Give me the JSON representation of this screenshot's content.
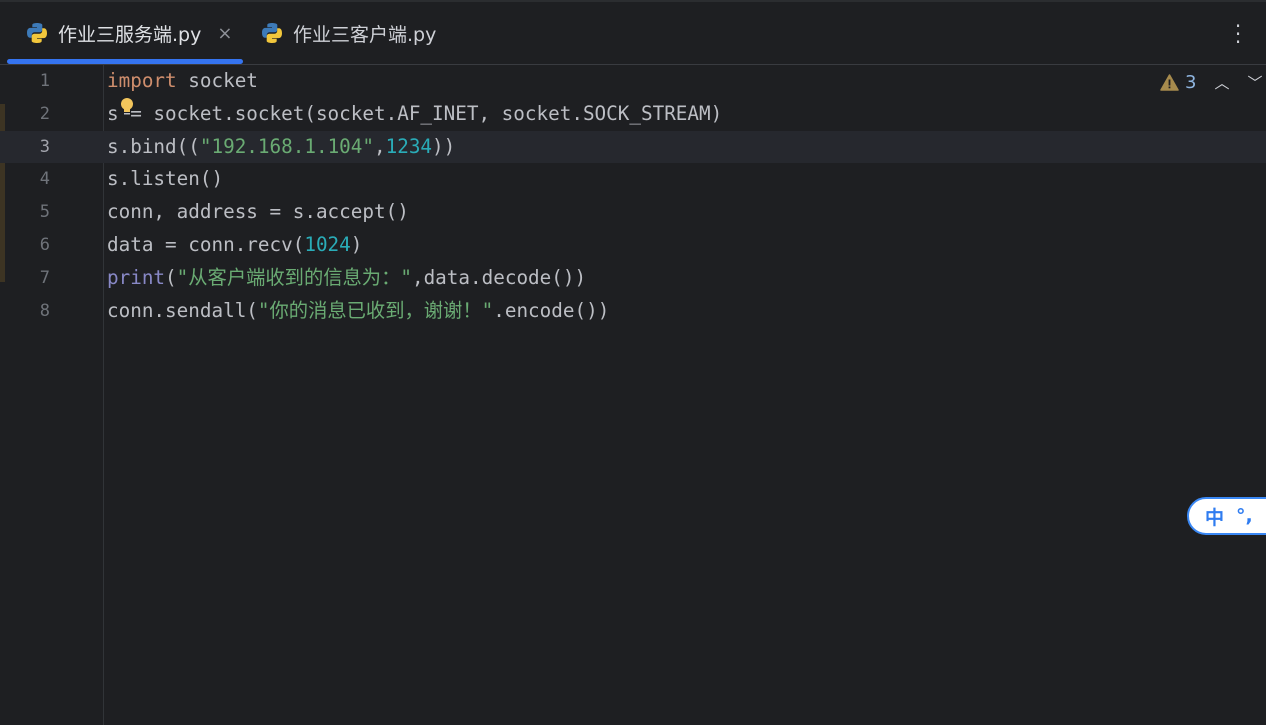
{
  "tabs": [
    {
      "label": "作业三服务端.py",
      "active": true,
      "icon": "python-icon"
    },
    {
      "label": "作业三客户端.py",
      "active": false,
      "icon": "python-icon"
    }
  ],
  "tab_close": "×",
  "more_menu": "⋮",
  "inspection": {
    "icon": "warning-icon",
    "count": "3",
    "prev": "⌃",
    "next": "⌄"
  },
  "current_line": 3,
  "lines": [
    {
      "n": "1",
      "tokens": [
        {
          "t": "import",
          "c": "kw"
        },
        {
          "t": " socket",
          "c": "df"
        }
      ]
    },
    {
      "n": "2",
      "tokens": [
        {
          "t": "s = socket.socket(socket.AF_INET, socket.SOCK_STREAM)",
          "c": "df"
        }
      ]
    },
    {
      "n": "3",
      "tokens": [
        {
          "t": "s.bind((",
          "c": "df"
        },
        {
          "t": "\"192.168.1.104\"",
          "c": "str"
        },
        {
          "t": ",",
          "c": "df"
        },
        {
          "t": "1234",
          "c": "num"
        },
        {
          "t": "))",
          "c": "df"
        }
      ]
    },
    {
      "n": "4",
      "tokens": [
        {
          "t": "s.listen()",
          "c": "df"
        }
      ]
    },
    {
      "n": "5",
      "tokens": [
        {
          "t": "conn, address = s.accept()",
          "c": "df"
        }
      ]
    },
    {
      "n": "6",
      "tokens": [
        {
          "t": "data = conn.recv(",
          "c": "df"
        },
        {
          "t": "1024",
          "c": "num"
        },
        {
          "t": ")",
          "c": "df"
        }
      ]
    },
    {
      "n": "7",
      "tokens": [
        {
          "t": "print",
          "c": "bi"
        },
        {
          "t": "(",
          "c": "df"
        },
        {
          "t": "\"从客户端收到的信息为：\"",
          "c": "str"
        },
        {
          "t": ",data.decode())",
          "c": "df"
        }
      ]
    },
    {
      "n": "8",
      "tokens": [
        {
          "t": "conn.sendall(",
          "c": "df"
        },
        {
          "t": "\"你的消息已收到，谢谢！\"",
          "c": "str"
        },
        {
          "t": ".encode())",
          "c": "df"
        }
      ]
    }
  ],
  "ime": {
    "mode": "中",
    "punct": "°,"
  },
  "colors": {
    "background": "#1e1f22",
    "accent": "#3574f0",
    "keyword": "#cf8e6d",
    "string": "#6aab73",
    "number": "#2aacb8",
    "builtin": "#8888c6",
    "warning": "#a68a4d"
  }
}
